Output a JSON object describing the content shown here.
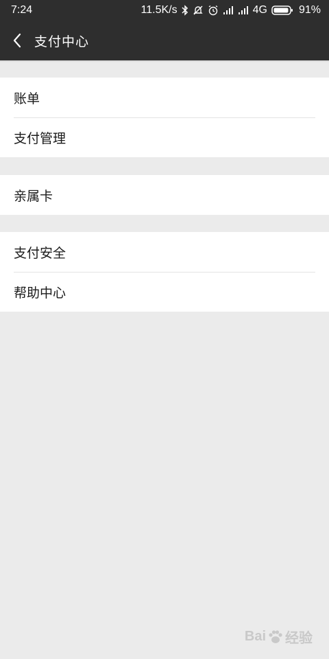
{
  "status_bar": {
    "time": "7:24",
    "net_speed": "11.5K/s",
    "network": "4G",
    "battery": "91%"
  },
  "header": {
    "title": "支付中心"
  },
  "menu_groups": [
    {
      "items": [
        {
          "label": "账单"
        },
        {
          "label": "支付管理"
        }
      ]
    },
    {
      "items": [
        {
          "label": "亲属卡"
        }
      ]
    },
    {
      "items": [
        {
          "label": "支付安全"
        },
        {
          "label": "帮助中心"
        }
      ]
    }
  ],
  "watermark": {
    "text_left": "Bai",
    "text_right": "经验"
  },
  "colors": {
    "header_bg": "#2e2e2e",
    "page_bg": "#ebebeb",
    "row_bg": "#ffffff"
  }
}
